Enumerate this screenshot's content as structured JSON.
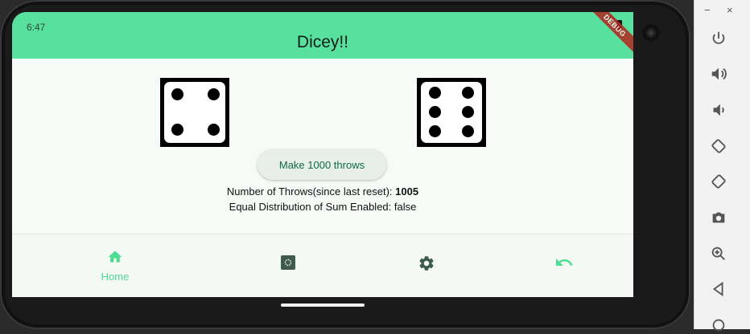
{
  "status_bar": {
    "time": "6:47"
  },
  "app_bar": {
    "title": "Dicey!!",
    "debug_banner": "DEBUG"
  },
  "dice": {
    "left_value": 4,
    "right_value": 6
  },
  "actions": {
    "throw_button": "Make 1000 throws"
  },
  "info": {
    "throws_label": "Number of Throws(since last reset): ",
    "throws_count": "1005",
    "distribution_text": "Equal Distribution of Sum Enabled: false"
  },
  "bottom_nav": {
    "items": [
      {
        "icon": "home-icon",
        "label": "Home",
        "selected": true
      },
      {
        "icon": "stats-icon",
        "label": "",
        "selected": false
      },
      {
        "icon": "settings-icon",
        "label": "",
        "selected": false
      },
      {
        "icon": "undo-icon",
        "label": "",
        "selected": false
      }
    ]
  },
  "emulator_controls": {
    "window_buttons": [
      "−",
      "×"
    ],
    "icons": [
      "power-icon",
      "volume-up-icon",
      "volume-down-icon",
      "rotate-left-icon",
      "rotate-right-icon",
      "camera-icon",
      "zoom-icon",
      "back-icon",
      "home-circle-icon"
    ]
  },
  "colors": {
    "accent": "#58e09e",
    "nav_selected": "#4ddc94",
    "button_text": "#0e6b4a"
  }
}
